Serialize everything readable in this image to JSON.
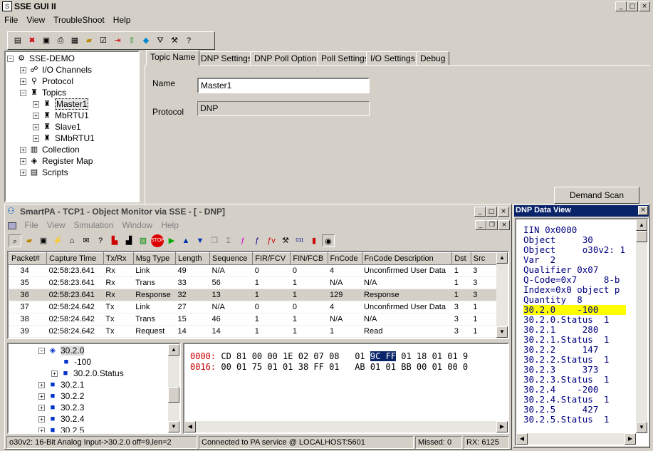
{
  "app": {
    "title": "SSE GUI II",
    "menu": [
      "File",
      "View",
      "TroubleShoot",
      "Help"
    ]
  },
  "tree": {
    "root": "SSE-DEMO",
    "items": [
      "I/O Channels",
      "Protocol",
      "Topics",
      "Master1",
      "MbRTU1",
      "Slave1",
      "SMbRTU1",
      "Collection",
      "Register Map",
      "Scripts"
    ]
  },
  "tabs": [
    "Topic Name",
    "DNP Settings",
    "DNP Poll Options",
    "Poll Settings",
    "I/O Settings",
    "Debug"
  ],
  "form": {
    "name_label": "Name",
    "name_value": "Master1",
    "protocol_label": "Protocol",
    "protocol_value": "DNP"
  },
  "demand_scan": "Demand Scan",
  "smartpa": {
    "title": "SmartPA  - TCP1 - Object Monitor via SSE - [ - DNP]",
    "menu": [
      "File",
      "View",
      "Simulation",
      "Window",
      "Help"
    ],
    "columns": [
      "Packet#",
      "Capture Time",
      "Tx/Rx",
      "Msg Type",
      "Length",
      "Sequence",
      "FIR/FCV",
      "FIN/FCB",
      "FnCode",
      "FnCode Description",
      "Dst",
      "Src"
    ],
    "rows": [
      [
        "34",
        "02:58:23.641",
        "Rx",
        "Link",
        "49",
        "N/A",
        "0",
        "0",
        "4",
        "Unconfirmed User Data",
        "1",
        "3"
      ],
      [
        "35",
        "02:58:23.641",
        "Rx",
        "Trans",
        "33",
        "56",
        "1",
        "1",
        "N/A",
        "N/A",
        "1",
        "3"
      ],
      [
        "36",
        "02:58:23.641",
        "Rx",
        "Response",
        "32",
        "13",
        "1",
        "1",
        "129",
        "Response",
        "1",
        "3"
      ],
      [
        "37",
        "02:58:24.642",
        "Tx",
        "Link",
        "27",
        "N/A",
        "0",
        "0",
        "4",
        "Unconfirmed User Data",
        "3",
        "1"
      ],
      [
        "38",
        "02:58:24.642",
        "Tx",
        "Trans",
        "15",
        "46",
        "1",
        "1",
        "N/A",
        "N/A",
        "3",
        "1"
      ],
      [
        "39",
        "02:58:24.642",
        "Tx",
        "Request",
        "14",
        "14",
        "1",
        "1",
        "1",
        "Read",
        "3",
        "1"
      ]
    ],
    "selected_row": 2,
    "obj_tree": [
      "30.2.0",
      "-100",
      "30.2.0.Status",
      "30.2.1",
      "30.2.2",
      "30.2.3",
      "30.2.4",
      "30.2.5"
    ],
    "hex": {
      "off1": "0000:",
      "line1a": "CD 81 00 00 1E 02 07 08   01",
      "line1sel": "9C FF",
      "line1b": "01 18 01 01 9",
      "off2": "0016:",
      "line2": "00 01 75 01 01 38 FF 01   AB 01 01 BB 00 01 00 0"
    },
    "status": {
      "left": "o30v2: 16-Bit Analog Input->30.2.0 off=9,len=2",
      "conn": "Connected to PA service @ LOCALHOST:5601",
      "missed": "Missed: 0",
      "rx": "RX: 6125"
    }
  },
  "dnp": {
    "title": "DNP Data View",
    "lines": [
      "IIN 0x0000",
      "Object     30",
      "Object     o30v2: 1",
      "Var  2",
      "Qualifier 0x07",
      "Q-Code=0x7     8-b",
      "Index=0x0 object p",
      "Quantity  8",
      "30.2.0    -100",
      "30.2.0.Status  1",
      "30.2.1     280",
      "30.2.1.Status  1",
      "30.2.2     147",
      "30.2.2.Status  1",
      "30.2.3     373",
      "30.2.3.Status  1",
      "30.2.4    -200",
      "30.2.4.Status  1",
      "30.2.5     427",
      "30.2.5.Status  1"
    ],
    "highlight": 8
  },
  "colors": {
    "titlebar": "#0a246a",
    "highlight_yellow": "#ffff00",
    "dnp_text": "#000080",
    "hex_offset": "#cc0000",
    "selection": "#0a246a"
  }
}
